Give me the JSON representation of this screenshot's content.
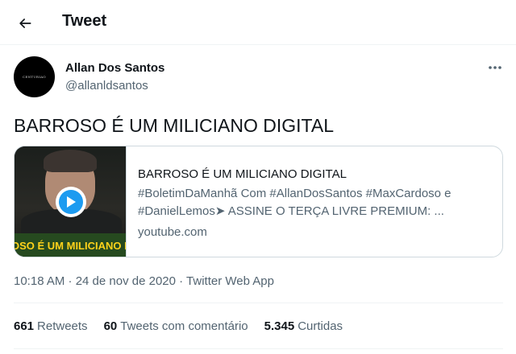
{
  "header": {
    "title": "Tweet"
  },
  "author": {
    "display_name": "Allan Dos Santos",
    "handle": "@allanldsantos",
    "avatar_text": "CENTURIAO"
  },
  "tweet": {
    "text": "BARROSO É UM MILICIANO DIGITAL"
  },
  "card": {
    "thumbnail_banner": "OSO É UM MILICIANO D",
    "title": "BARROSO É UM MILICIANO DIGITAL",
    "description": "#BoletimDaManhã Com #AllanDosSantos #MaxCardoso e #DanielLemos➤ ASSINE O TERÇA LIVRE PREMIUM: ...",
    "domain": "youtube.com"
  },
  "meta": {
    "timestamp": "10:18 AM · 24 de nov de 2020 · Twitter Web App"
  },
  "stats": {
    "retweets": {
      "count": "661",
      "label": "Retweets"
    },
    "comments": {
      "count": "60",
      "label": "Tweets com comentário"
    },
    "likes": {
      "count": "5.345",
      "label": "Curtidas"
    }
  },
  "colors": {
    "text": "#0f1419",
    "secondary": "#536471",
    "accent": "#1d9bf0",
    "border": "#cfd9de"
  }
}
